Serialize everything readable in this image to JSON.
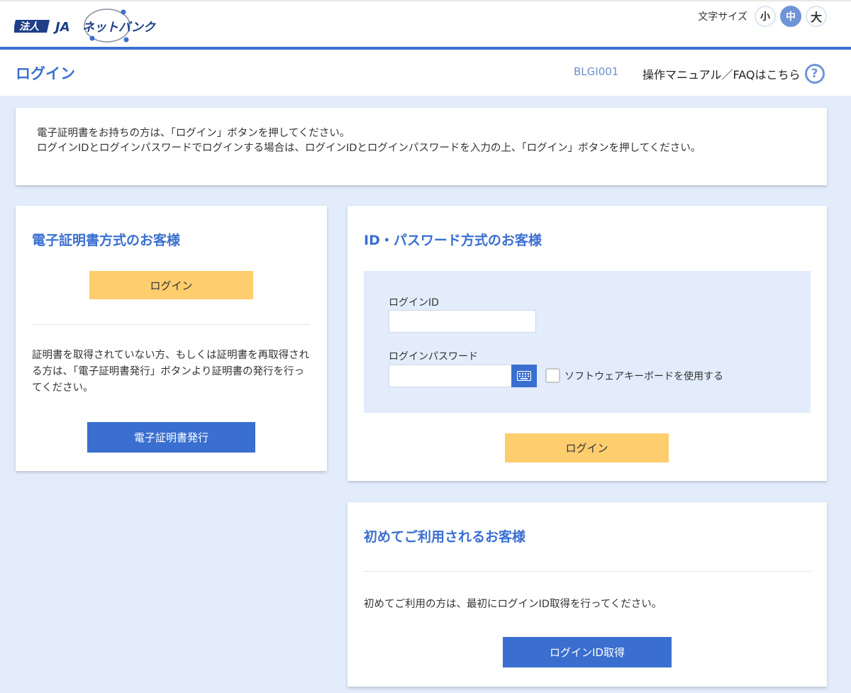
{
  "header": {
    "logo_text": "法人JAネットバンク",
    "font_size_label": "文字サイズ",
    "font_sizes": [
      "小",
      "中",
      "大"
    ],
    "active_font_size": "中"
  },
  "title_bar": {
    "page_title": "ログイン",
    "screen_id": "BLGI001",
    "manual_link": "操作マニュアル／FAQはこちら",
    "help_icon": "?"
  },
  "notice": {
    "line1": "電子証明書をお持ちの方は、「ログイン」ボタンを押してください。",
    "line2": "ログインIDとログインパスワードでログインする場合は、ログインIDとログインパスワードを入力の上、「ログイン」ボタンを押してください。"
  },
  "cert_card": {
    "title": "電子証明書方式のお客様",
    "login_button": "ログイン",
    "description": "証明書を取得されていない方、もしくは証明書を再取得される方は、「電子証明書発行」ボタンより証明書の発行を行ってください。",
    "issue_button": "電子証明書発行"
  },
  "id_card": {
    "title": "ID・パスワード方式のお客様",
    "login_id_label": "ログインID",
    "login_id_value": "",
    "password_label": "ログインパスワード",
    "password_value": "",
    "software_keyboard_label": "ソフトウェアキーボードを使用する",
    "software_keyboard_checked": false,
    "login_button": "ログイン"
  },
  "first_card": {
    "title": "初めてご利用されるお客様",
    "description": "初めてご利用の方は、最初にログインID取得を行ってください。",
    "get_id_button": "ログインID取得"
  },
  "colors": {
    "primary": "#3a6fd0",
    "accent_yellow": "#fdcd6e",
    "background": "#e2ecfb"
  }
}
